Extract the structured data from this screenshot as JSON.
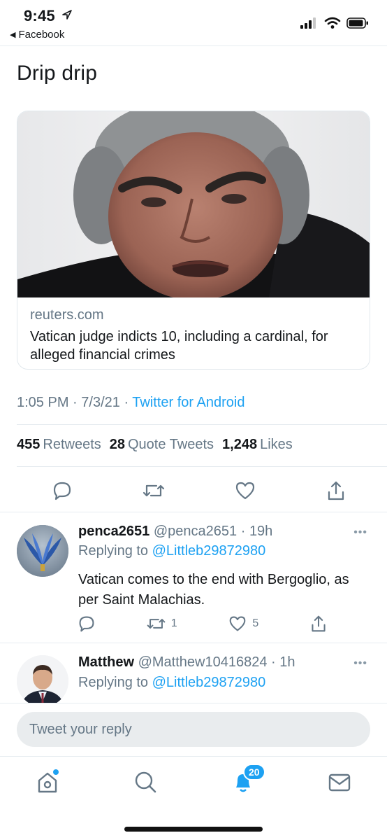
{
  "status": {
    "time": "9:45",
    "back_app": "Facebook"
  },
  "tweet": {
    "text": "Drip drip",
    "card": {
      "domain": "reuters.com",
      "title": "Vatican judge indicts 10, including a cardinal, for alleged financial crimes"
    },
    "meta": {
      "time": "1:05 PM",
      "date": "7/3/21",
      "app": "Twitter for Android"
    },
    "stats": {
      "retweets": "455",
      "retweets_label": "Retweets",
      "quotes": "28",
      "quotes_label": "Quote Tweets",
      "likes": "1,248",
      "likes_label": "Likes"
    }
  },
  "replies": [
    {
      "name": "penca2651",
      "handle": "@penca2651",
      "time": "19h",
      "replying_label": "Replying to",
      "replying_to": "@Littleb29872980",
      "text": "Vatican comes to the end with Bergoglio, as per Saint Malachias.",
      "retweets": "1",
      "likes": "5"
    },
    {
      "name": "Matthew",
      "handle": "@Matthew10416824",
      "time": "1h",
      "replying_label": "Replying to",
      "replying_to": "@Littleb29872980"
    }
  ],
  "compose": {
    "placeholder": "Tweet your reply"
  },
  "tabbar": {
    "notifications_badge": "20"
  },
  "colors": {
    "accent": "#1da1f2",
    "secondary_text": "#657786",
    "divider": "#e6ecf0"
  },
  "icons": [
    "location-arrow-icon",
    "signal-icon",
    "wifi-icon",
    "battery-icon",
    "reply-icon",
    "retweet-icon",
    "like-icon",
    "share-icon",
    "more-icon",
    "home-icon",
    "search-icon",
    "notifications-icon",
    "messages-icon"
  ]
}
